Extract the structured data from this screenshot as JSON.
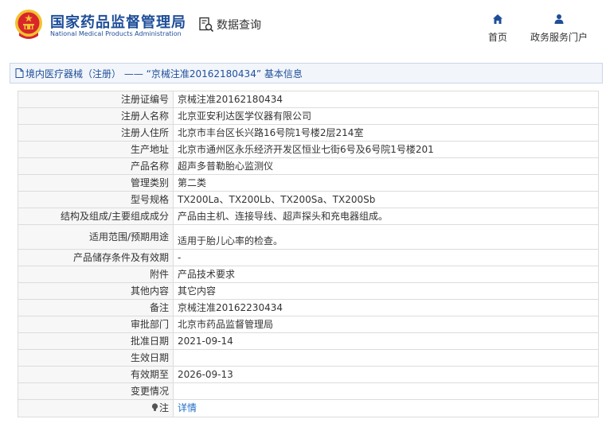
{
  "header": {
    "title": "国家药品监督管理局",
    "subtitle": "National Medical Products Administration",
    "search_label": "数据查询",
    "nav": [
      {
        "label": "首页",
        "icon": "home-icon"
      },
      {
        "label": "政务服务门户",
        "icon": "user-icon"
      }
    ]
  },
  "breadcrumb": {
    "text": "境内医疗器械（注册） —— “京械注准20162180434” 基本信息",
    "icon": "document-icon"
  },
  "details": [
    {
      "key": "注册证编号",
      "value": "京械注准20162180434"
    },
    {
      "key": "注册人名称",
      "value": "北京亚安利达医学仪器有限公司"
    },
    {
      "key": "注册人住所",
      "value": "北京市丰台区长兴路16号院1号楼2层214室"
    },
    {
      "key": "生产地址",
      "value": "北京市通州区永乐经济开发区恒业七街6号及6号院1号楼201"
    },
    {
      "key": "产品名称",
      "value": "超声多普勒胎心监测仪"
    },
    {
      "key": "管理类别",
      "value": "第二类"
    },
    {
      "key": "型号规格",
      "value": "TX200La、TX200Lb、TX200Sa、TX200Sb"
    },
    {
      "key": "结构及组成/主要组成成分",
      "value": "产品由主机、连接导线、超声探头和充电器组成。"
    },
    {
      "key": "适用范围/预期用途",
      "value": "适用于胎儿心率的检查。"
    },
    {
      "key": "产品储存条件及有效期",
      "value": "-"
    },
    {
      "key": "附件",
      "value": "产品技术要求"
    },
    {
      "key": "其他内容",
      "value": "其它内容"
    },
    {
      "key": "备注",
      "value": "京械注准20162230434"
    },
    {
      "key": "审批部门",
      "value": "北京市药品监督管理局"
    },
    {
      "key": "批准日期",
      "value": "2021-09-14"
    },
    {
      "key": "生效日期",
      "value": ""
    },
    {
      "key": "有效期至",
      "value": "2026-09-13"
    },
    {
      "key": "变更情况",
      "value": ""
    }
  ],
  "note_row": {
    "key": "注",
    "link": "详情",
    "icon": "lightbulb-icon"
  },
  "colors": {
    "brand_blue": "#1f4e99",
    "link_blue": "#1f6ec4",
    "emblem_red": "#d8262b",
    "emblem_gold": "#f2c230"
  }
}
